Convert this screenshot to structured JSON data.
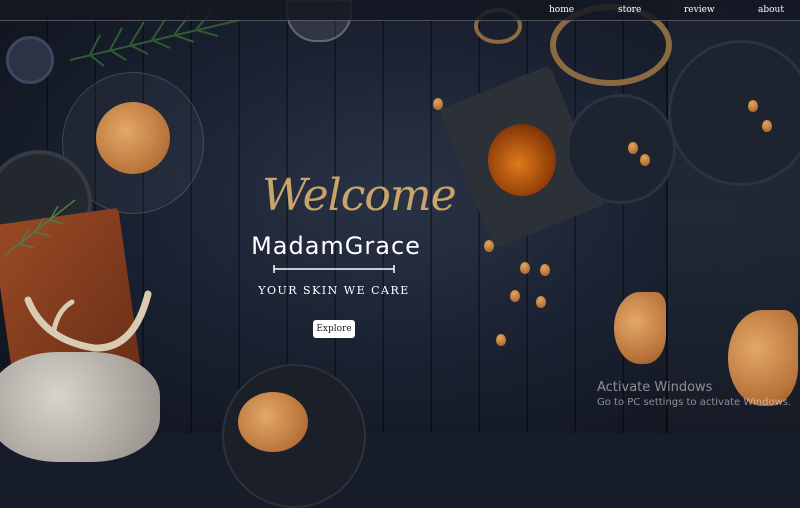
{
  "nav": {
    "items": [
      {
        "label": "home"
      },
      {
        "label": "store"
      },
      {
        "label": "review"
      },
      {
        "label": "about"
      }
    ]
  },
  "hero": {
    "welcome": "Welcome",
    "brand": "MadamGrace",
    "tagline": "YOUR SKIN WE CARE",
    "cta_label": "Explore"
  },
  "watermark": {
    "title": "Activate Windows",
    "subtitle": "Go to PC settings to activate Windows."
  },
  "colors": {
    "background": "#161c2a",
    "accent_gold": "#c9a46b",
    "text": "#ffffff"
  }
}
